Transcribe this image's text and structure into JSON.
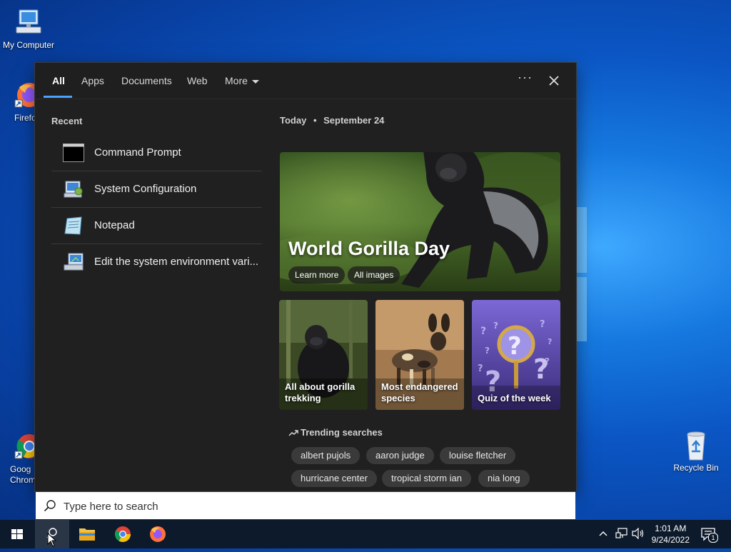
{
  "desktop": {
    "icons": [
      {
        "label": "My Computer"
      },
      {
        "label": "Firefo"
      },
      {
        "label": "Goog Chrom"
      },
      {
        "label": "Recycle Bin"
      }
    ]
  },
  "search_panel": {
    "tabs": [
      {
        "label": "All",
        "active": true
      },
      {
        "label": "Apps"
      },
      {
        "label": "Documents"
      },
      {
        "label": "Web"
      },
      {
        "label": "More"
      }
    ],
    "more_options_label": "···",
    "recent": {
      "heading": "Recent",
      "items": [
        {
          "label": "Command Prompt",
          "icon": "command-prompt-icon"
        },
        {
          "label": "System Configuration",
          "icon": "system-configuration-icon"
        },
        {
          "label": "Notepad",
          "icon": "notepad-icon"
        },
        {
          "label": "Edit the system environment vari...",
          "icon": "system-properties-icon"
        }
      ]
    },
    "today": {
      "label": "Today",
      "separator": "•",
      "date": "September 24"
    },
    "hero": {
      "title": "World Gorilla Day",
      "learn_more": "Learn more",
      "all_images": "All images"
    },
    "cards": [
      {
        "line1": "All about gorilla",
        "line2": "trekking"
      },
      {
        "line1": "Most endangered",
        "line2": "species"
      },
      {
        "line1": "Quiz of the week",
        "line2": ""
      }
    ],
    "trending": {
      "heading": "Trending searches",
      "items": [
        "albert pujols",
        "aaron judge",
        "louise fletcher",
        "hurricane center",
        "tropical storm ian",
        "nia long"
      ]
    }
  },
  "search_box": {
    "placeholder": "Type here to search",
    "value": ""
  },
  "taskbar": {
    "time": "1:01 AM",
    "date": "9/24/2022",
    "notification_count": "1"
  },
  "colors": {
    "accent": "#4aa3ff",
    "panel_bg": "#202020",
    "taskbar_bg": "#0d1a2b"
  }
}
